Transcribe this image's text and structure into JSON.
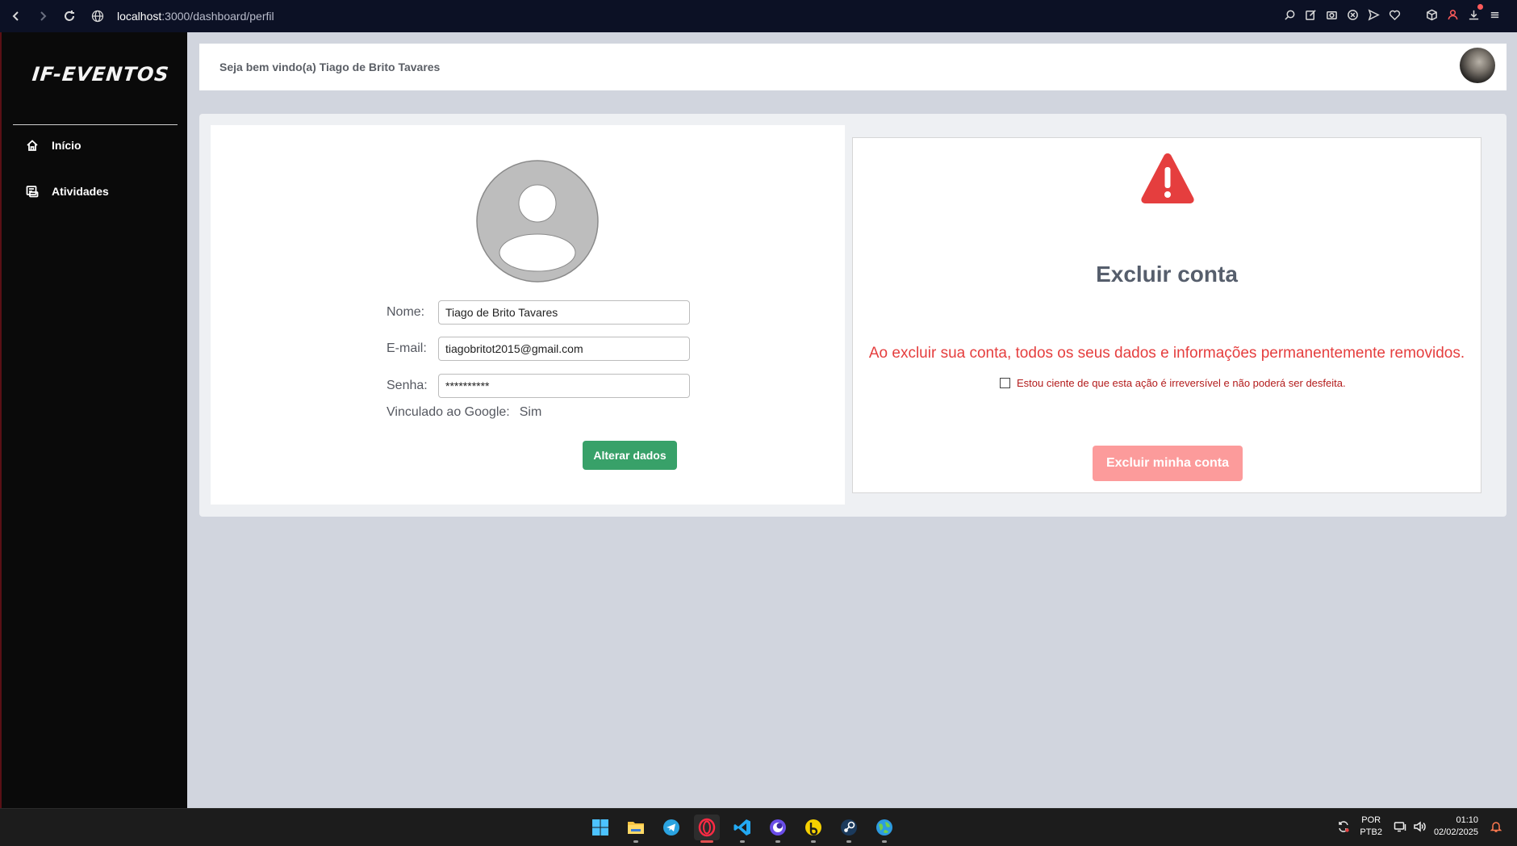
{
  "browser": {
    "url_host": "localhost",
    "url_path": ":3000/dashboard/perfil"
  },
  "sidebar": {
    "logo": "IF-EVENTOS",
    "items": [
      {
        "label": "Início",
        "icon": "home-icon"
      },
      {
        "label": "Atividades",
        "icon": "activities-icon"
      }
    ]
  },
  "header": {
    "welcome": "Seja bem vindo(a) Tiago de Brito Tavares"
  },
  "profile": {
    "name_label": "Nome:",
    "name_value": "Tiago de Brito Tavares",
    "email_label": "E-mail:",
    "email_value": "tiagobritot2015@gmail.com",
    "password_label": "Senha:",
    "password_value": "**********",
    "google_label": "Vinculado ao Google:",
    "google_value": "Sim",
    "update_button": "Alterar dados"
  },
  "delete_account": {
    "title": "Excluir conta",
    "description": "Ao excluir sua conta, todos os seus dados e informações permanentemente removidos.",
    "confirm_label": "Estou ciente de que esta ação é irreversível e não poderá ser desfeita.",
    "confirm_checked": false,
    "button": "Excluir minha conta"
  },
  "taskbar": {
    "apps": [
      "windows-start-icon",
      "file-explorer-icon",
      "telegram-icon",
      "opera-gx-icon",
      "vscode-icon",
      "browser-app-icon",
      "b-app-icon",
      "steam-icon",
      "globe-app-icon"
    ],
    "active_app": "opera-gx-icon",
    "lang_top": "POR",
    "lang_bottom": "PTB2",
    "time": "01:10",
    "date": "02/02/2025"
  },
  "colors": {
    "sidebar_bg": "#0a0a0a",
    "page_bg": "#d1d5de",
    "primary_green": "#38a169",
    "danger_red": "#e53e3e",
    "danger_button_disabled": "#fc9b9b"
  }
}
